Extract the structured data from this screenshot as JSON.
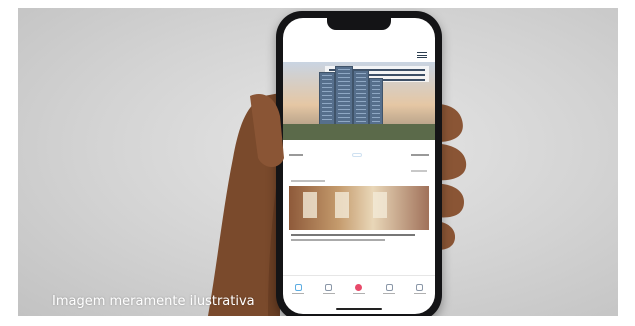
{
  "caption": {
    "text": "Imagem meramente ilustrativa"
  },
  "icons": {
    "menu": "menu-icon",
    "tabs": [
      "home-icon",
      "calendar-icon",
      "pin-icon",
      "chat-icon",
      "profile-icon"
    ]
  },
  "colors": {
    "accent": "#2e86c1",
    "tab_highlight": "#e84a6a",
    "caption_text": "#ffffff"
  }
}
